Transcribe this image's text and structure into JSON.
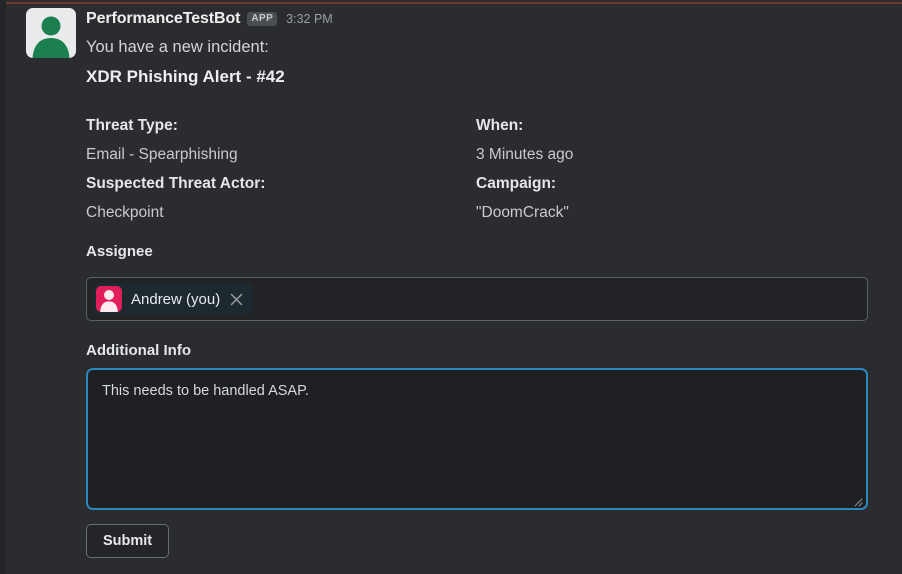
{
  "window": {
    "background_color": "#2a2c2f",
    "top_rule_color": "#6b3a2c"
  },
  "message": {
    "author": "PerformanceTestBot",
    "app_badge": "APP",
    "timestamp": "3:32 PM",
    "intro": "You have a new incident:",
    "alert_title": "XDR Phishing Alert - #42",
    "avatar_icon": "person-avatar-icon"
  },
  "fields": {
    "left": [
      {
        "label": "Threat Type:",
        "value": "Email - Spearphishing"
      },
      {
        "label": "Suspected Threat Actor:",
        "value": "Checkpoint"
      }
    ],
    "right": [
      {
        "label": "When:",
        "value": "3 Minutes ago"
      },
      {
        "label": "Campaign:",
        "value": "\"DoomCrack\""
      }
    ]
  },
  "assignee": {
    "label": "Assignee",
    "chip": {
      "name": "Andrew (you)",
      "avatar_icon": "person-avatar-icon",
      "avatar_color": "#e01e5a",
      "remove_icon": "close-icon"
    }
  },
  "additional_info": {
    "label": "Additional Info",
    "value": "This needs to be handled ASAP.",
    "placeholder": "",
    "focus_border_color": "#2b87bd",
    "resize_icon": "resize-grip-icon"
  },
  "submit": {
    "label": "Submit"
  }
}
